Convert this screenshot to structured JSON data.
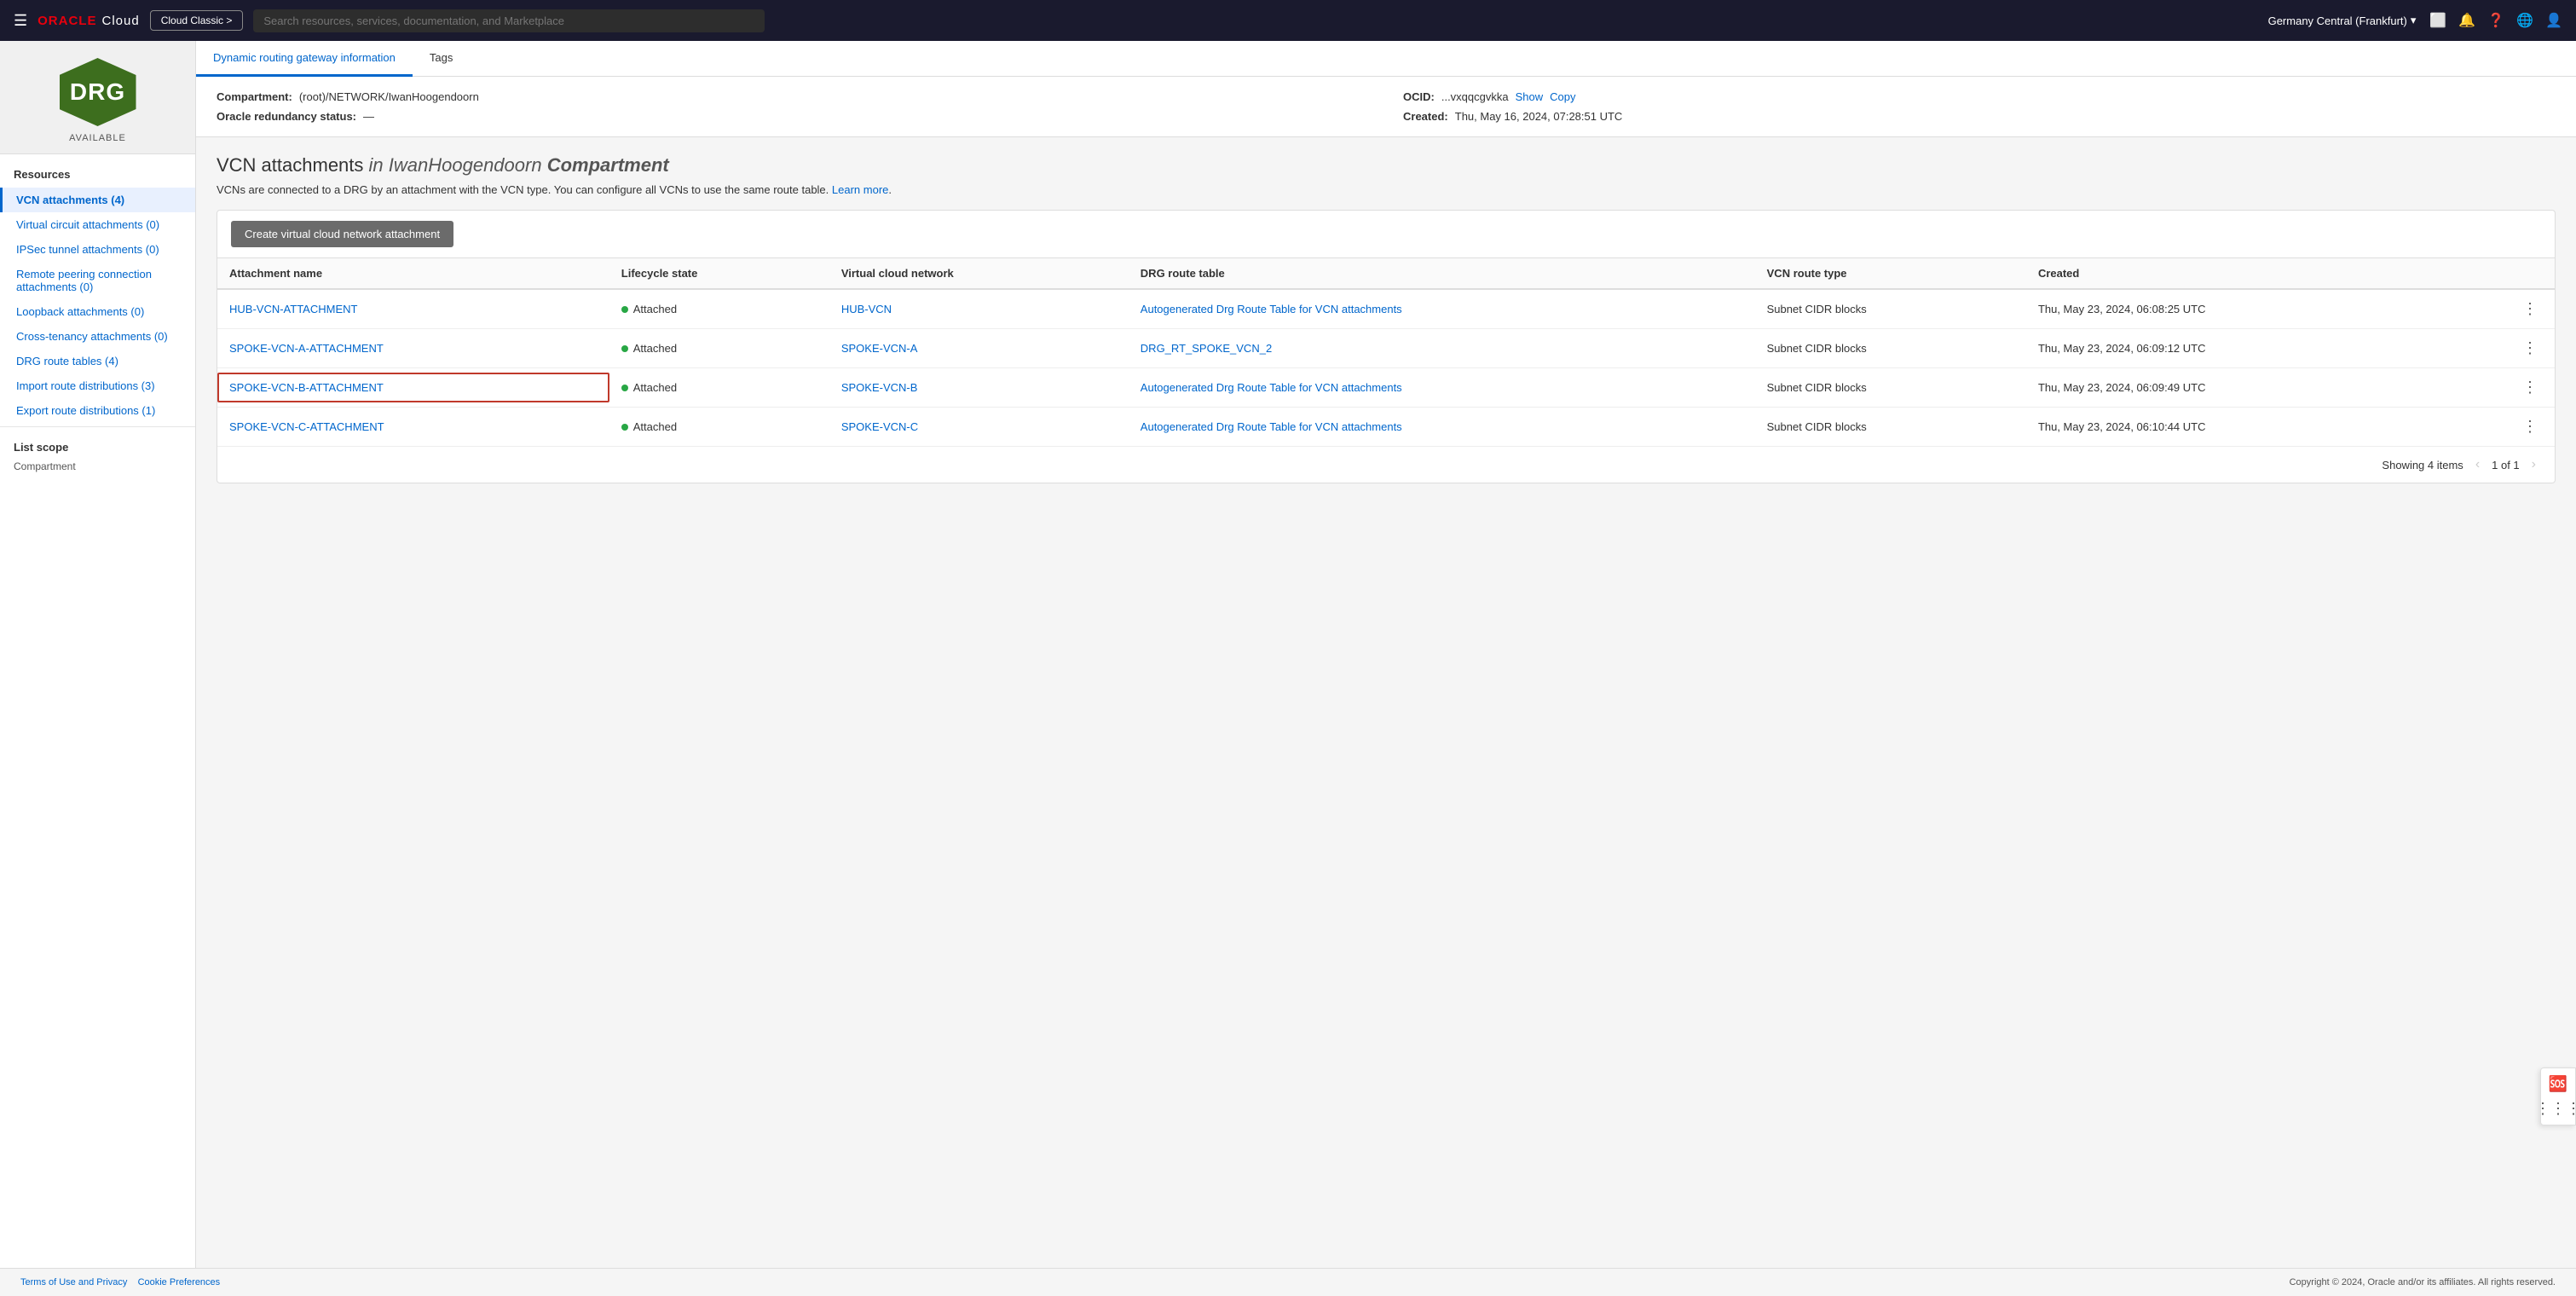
{
  "nav": {
    "hamburger": "☰",
    "logo_oracle": "ORACLE",
    "logo_cloud": "Cloud",
    "classic_btn": "Cloud Classic >",
    "search_placeholder": "Search resources, services, documentation, and Marketplace",
    "region": "Germany Central (Frankfurt)",
    "region_arrow": "▾"
  },
  "sidebar": {
    "drg_text": "DRG",
    "status": "AVAILABLE",
    "resources_title": "Resources",
    "items": [
      {
        "label": "VCN attachments (4)",
        "active": true
      },
      {
        "label": "Virtual circuit attachments (0)",
        "active": false
      },
      {
        "label": "IPSec tunnel attachments (0)",
        "active": false
      },
      {
        "label": "Remote peering connection attachments (0)",
        "active": false
      },
      {
        "label": "Loopback attachments (0)",
        "active": false
      },
      {
        "label": "Cross-tenancy attachments (0)",
        "active": false
      },
      {
        "label": "DRG route tables (4)",
        "active": false
      },
      {
        "label": "Import route distributions (3)",
        "active": false
      },
      {
        "label": "Export route distributions (1)",
        "active": false
      }
    ],
    "list_scope_title": "List scope",
    "compartment_label": "Compartment"
  },
  "info_tabs": [
    {
      "label": "Dynamic routing gateway information",
      "active": true
    },
    {
      "label": "Tags",
      "active": false
    }
  ],
  "info": {
    "compartment_label": "Compartment:",
    "compartment_value": "(root)/NETWORK/IwanHoogendoorn",
    "ocid_label": "OCID:",
    "ocid_value": "...vxqqcgvkka",
    "ocid_show": "Show",
    "ocid_copy": "Copy",
    "redundancy_label": "Oracle redundancy status:",
    "redundancy_value": "—",
    "created_label": "Created:",
    "created_value": "Thu, May 16, 2024, 07:28:51 UTC"
  },
  "vcn_section": {
    "title_prefix": "VCN attachments",
    "title_italic": "in IwanHoogendoorn",
    "title_compartment": "Compartment",
    "description": "VCNs are connected to a DRG by an attachment with the VCN type. You can configure all VCNs to use the same route table.",
    "learn_more": "Learn more",
    "create_btn": "Create virtual cloud network attachment"
  },
  "table": {
    "columns": [
      "Attachment name",
      "Lifecycle state",
      "Virtual cloud network",
      "DRG route table",
      "VCN route type",
      "Created"
    ],
    "rows": [
      {
        "name": "HUB-VCN-ATTACHMENT",
        "lifecycle": "Attached",
        "vcn": "HUB-VCN",
        "drg_route": "Autogenerated Drg Route Table for VCN attachments",
        "vcn_route_type": "Subnet CIDR blocks",
        "created": "Thu, May 23, 2024, 06:08:25 UTC",
        "highlighted": false
      },
      {
        "name": "SPOKE-VCN-A-ATTACHMENT",
        "lifecycle": "Attached",
        "vcn": "SPOKE-VCN-A",
        "drg_route": "DRG_RT_SPOKE_VCN_2",
        "vcn_route_type": "Subnet CIDR blocks",
        "created": "Thu, May 23, 2024, 06:09:12 UTC",
        "highlighted": false
      },
      {
        "name": "SPOKE-VCN-B-ATTACHMENT",
        "lifecycle": "Attached",
        "vcn": "SPOKE-VCN-B",
        "drg_route": "Autogenerated Drg Route Table for VCN attachments",
        "vcn_route_type": "Subnet CIDR blocks",
        "created": "Thu, May 23, 2024, 06:09:49 UTC",
        "highlighted": true
      },
      {
        "name": "SPOKE-VCN-C-ATTACHMENT",
        "lifecycle": "Attached",
        "vcn": "SPOKE-VCN-C",
        "drg_route": "Autogenerated Drg Route Table for VCN attachments",
        "vcn_route_type": "Subnet CIDR blocks",
        "created": "Thu, May 23, 2024, 06:10:44 UTC",
        "highlighted": false
      }
    ],
    "showing": "Showing 4 items",
    "page": "1 of 1"
  },
  "footer": {
    "terms": "Terms of Use and Privacy",
    "cookies": "Cookie Preferences",
    "copyright": "Copyright © 2024, Oracle and/or its affiliates. All rights reserved."
  }
}
